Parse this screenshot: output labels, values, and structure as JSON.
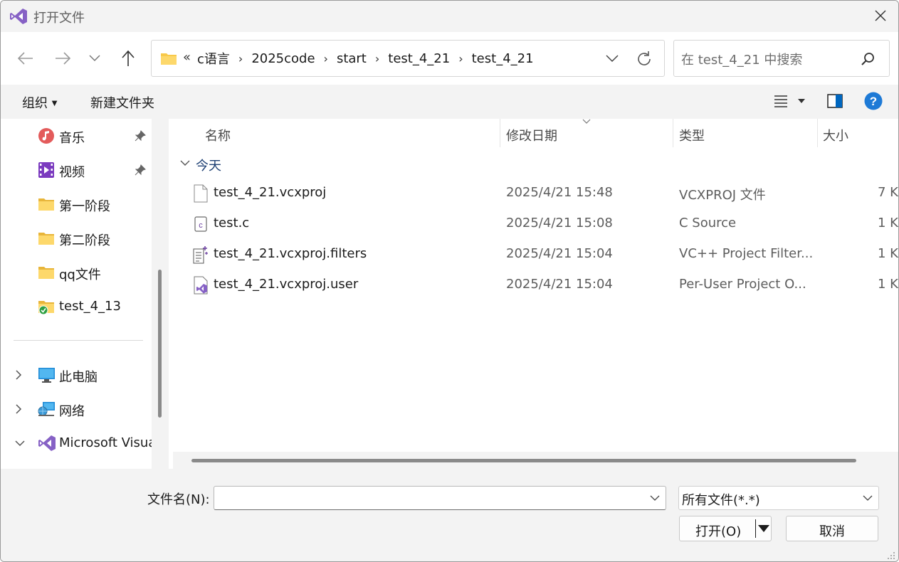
{
  "window": {
    "title": "打开文件"
  },
  "nav": {
    "breadcrumb_prefix": "«",
    "crumbs": [
      "c语言",
      "2025code",
      "start",
      "test_4_21",
      "test_4_21"
    ],
    "search_placeholder": "在 test_4_21 中搜索"
  },
  "toolbar": {
    "organize_label": "组织",
    "new_folder_label": "新建文件夹"
  },
  "sidebar": {
    "items": [
      {
        "label": "音乐",
        "icon": "music-icon",
        "pinned": true
      },
      {
        "label": "视频",
        "icon": "video-icon",
        "pinned": true
      },
      {
        "label": "第一阶段",
        "icon": "folder-icon"
      },
      {
        "label": "第二阶段",
        "icon": "folder-icon"
      },
      {
        "label": "qq文件",
        "icon": "folder-icon"
      },
      {
        "label": "test_4_13",
        "icon": "folder-synced-icon"
      }
    ],
    "tree": [
      {
        "label": "此电脑",
        "icon": "computer-icon",
        "expanded": false
      },
      {
        "label": "网络",
        "icon": "network-icon",
        "expanded": false
      },
      {
        "label": "Microsoft Visua",
        "icon": "visual-studio-icon",
        "expanded": true
      }
    ]
  },
  "columns": {
    "name": "名称",
    "date": "修改日期",
    "type": "类型",
    "size": "大小"
  },
  "group": {
    "label": "今天"
  },
  "files": [
    {
      "name": "test_4_21.vcxproj",
      "date": "2025/4/21 15:48",
      "type": "VCXPROJ 文件",
      "size": "7 K",
      "icon": "document-icon"
    },
    {
      "name": "test.c",
      "date": "2025/4/21 15:08",
      "type": "C Source",
      "size": "1 K",
      "icon": "c-source-icon"
    },
    {
      "name": "test_4_21.vcxproj.filters",
      "date": "2025/4/21 15:04",
      "type": "VC++ Project Filter...",
      "size": "1 K",
      "icon": "filters-file-icon"
    },
    {
      "name": "test_4_21.vcxproj.user",
      "date": "2025/4/21 15:04",
      "type": "Per-User Project O...",
      "size": "1 K",
      "icon": "vs-user-file-icon"
    }
  ],
  "bottom": {
    "filename_label": "文件名(N):",
    "filename_value": "",
    "filetype_value": "所有文件(*.*)",
    "open_label": "打开(O)",
    "cancel_label": "取消"
  },
  "colors": {
    "accent": "#0067c0",
    "folder": "#f8c94a",
    "vs_purple": "#8661c5"
  }
}
